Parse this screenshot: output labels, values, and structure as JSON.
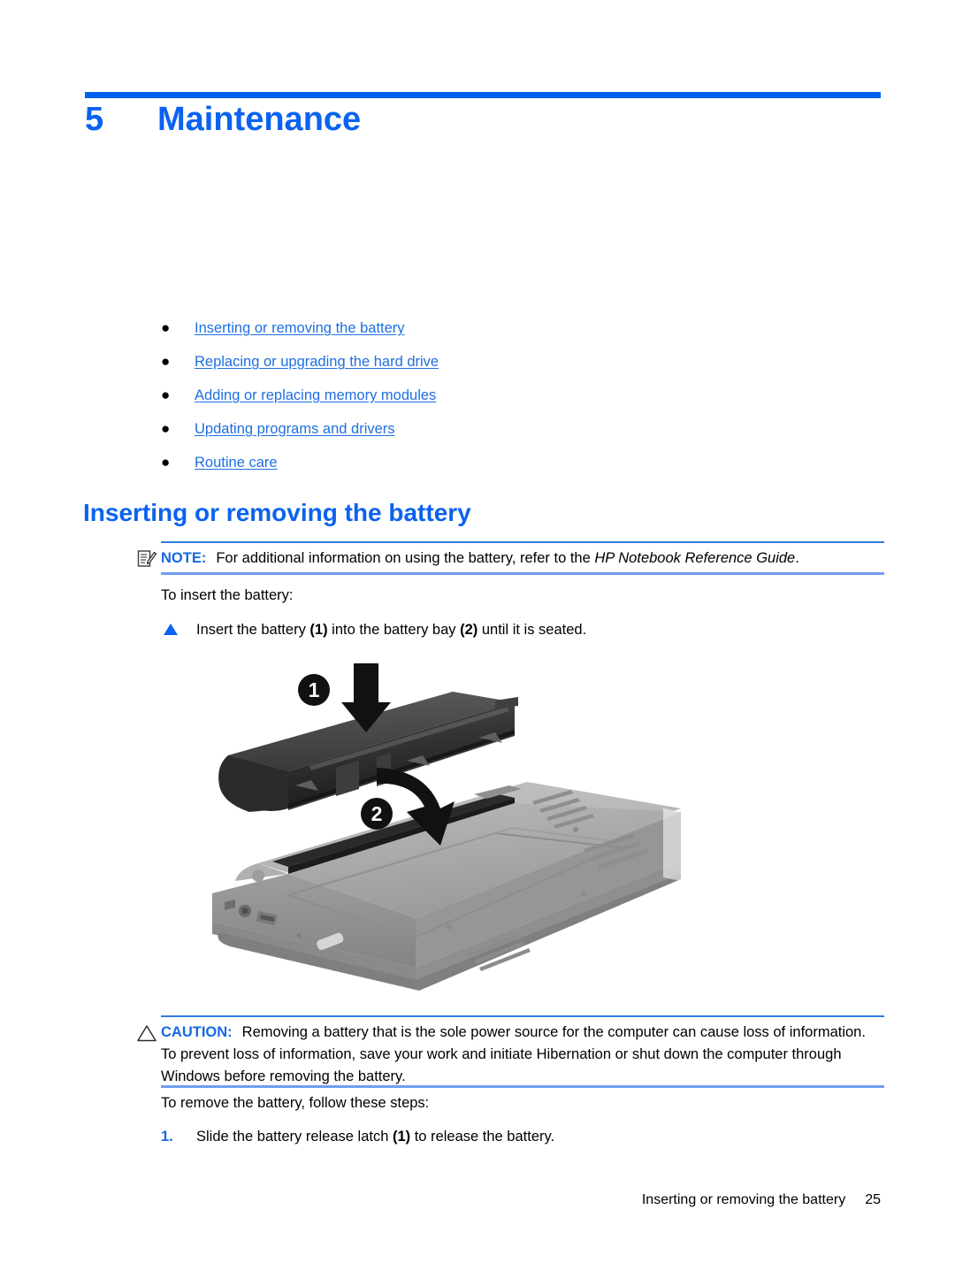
{
  "chapter": {
    "number": "5",
    "title": "Maintenance",
    "accent_color": "#0a62f0"
  },
  "toc_links": [
    {
      "bullet": "●",
      "label": "Inserting or removing the battery"
    },
    {
      "bullet": "●",
      "label": "Replacing or upgrading the hard drive"
    },
    {
      "bullet": "●",
      "label": "Adding or replacing memory modules"
    },
    {
      "bullet": "●",
      "label": "Updating programs and drivers"
    },
    {
      "bullet": "●",
      "label": "Routine care"
    }
  ],
  "section": {
    "heading": "Inserting or removing the battery"
  },
  "note": {
    "icon": "note-pencil-icon",
    "label": "NOTE:",
    "text_before": "For additional information on using the battery, refer to the ",
    "text_italic": "HP Notebook Reference Guide",
    "text_after": ".",
    "border_color": "#2f7de1",
    "label_color": "#1668e3"
  },
  "insert": {
    "intro": "To insert the battery:",
    "step_bullet": "triangle-bullet-icon",
    "step_text_1": "Insert the battery ",
    "step_callout_1": "(1)",
    "step_text_2": " into the battery bay ",
    "step_callout_2": "(2)",
    "step_text_3": " until it is seated."
  },
  "figure": {
    "name": "battery-insertion-illustration",
    "caption": "",
    "callouts": [
      {
        "id": "1",
        "meaning": "battery"
      },
      {
        "id": "2",
        "meaning": "battery bay"
      }
    ]
  },
  "caution": {
    "icon": "warning-triangle-icon",
    "label": "CAUTION:",
    "text": "Removing a battery that is the sole power source for the computer can cause loss of information. To prevent loss of information, save your work and initiate Hibernation or shut down the computer through Windows before removing the battery.",
    "border_color": "#2f7de1",
    "label_color": "#1668e3"
  },
  "remove": {
    "intro": "To remove the battery, follow these steps:",
    "steps": [
      {
        "number": "1.",
        "text_1": "Slide the battery release latch ",
        "callout": "(1)",
        "text_2": " to release the battery."
      }
    ]
  },
  "footer": {
    "section_title": "Inserting or removing the battery",
    "page_number": "25"
  }
}
